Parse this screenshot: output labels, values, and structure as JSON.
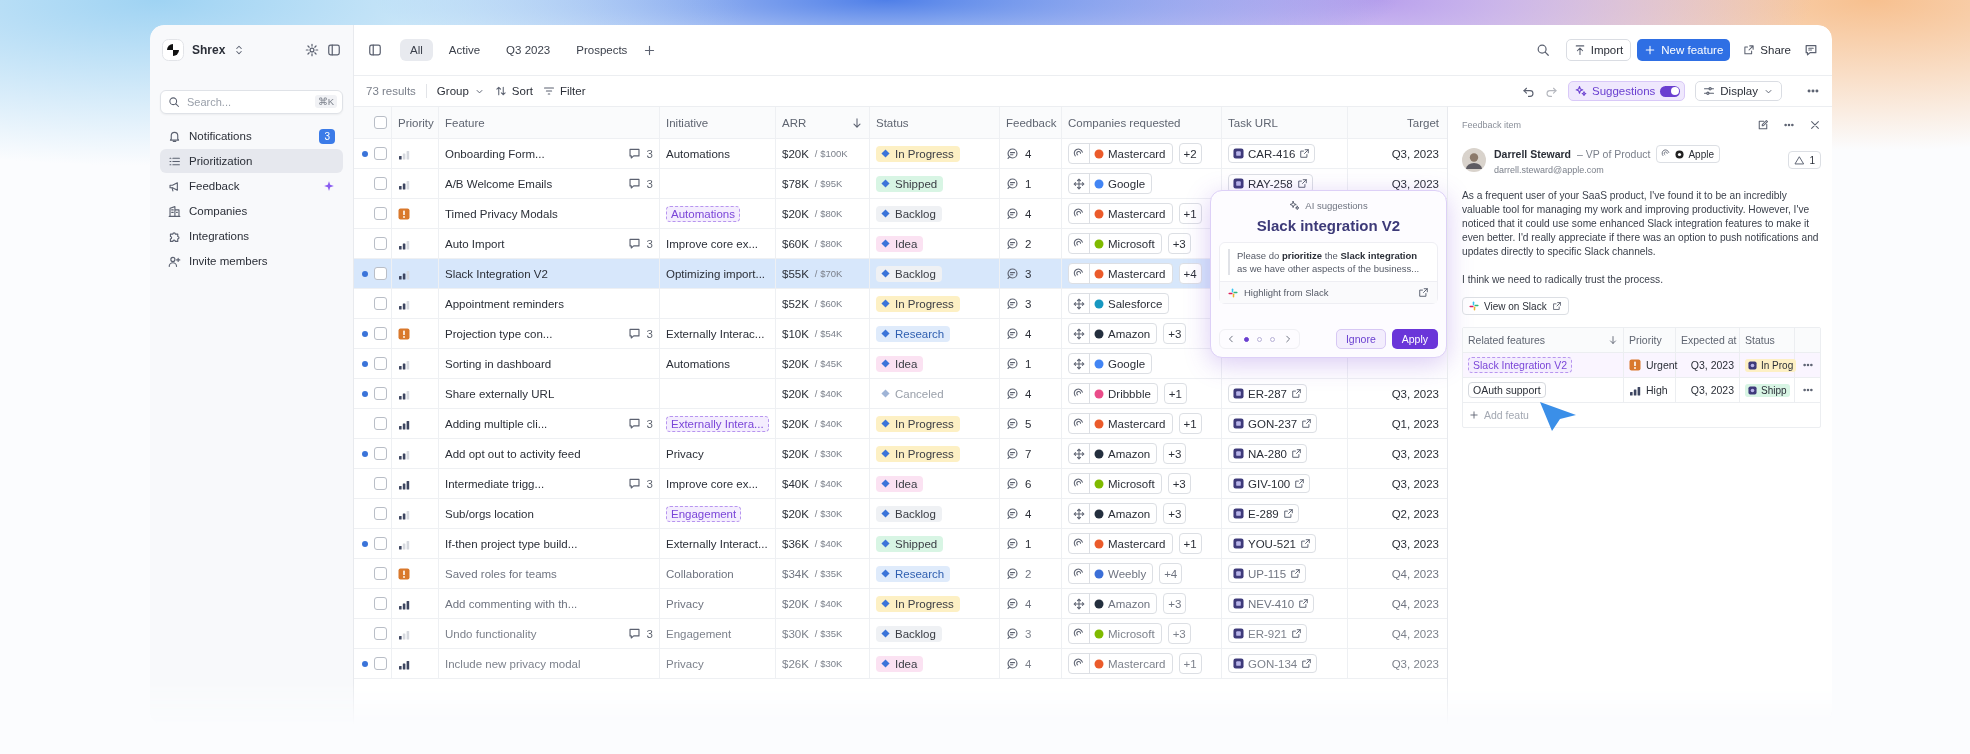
{
  "sidebar": {
    "workspace": "Shrex",
    "search": {
      "placeholder": "Search...",
      "shortcut": "⌘K"
    },
    "items": [
      {
        "label": "Notifications",
        "selected": false,
        "badge": "3"
      },
      {
        "label": "Prioritization",
        "selected": true
      },
      {
        "label": "Feedback",
        "selected": false
      },
      {
        "label": "Companies",
        "selected": false
      },
      {
        "label": "Integrations",
        "selected": false
      },
      {
        "label": "Invite members",
        "selected": false
      }
    ]
  },
  "tabs": [
    {
      "label": "All",
      "selected": true
    },
    {
      "label": "Active",
      "selected": false
    },
    {
      "label": "Q3 2023",
      "selected": false
    },
    {
      "label": "Prospects",
      "selected": false
    }
  ],
  "header_actions": {
    "import": "Import",
    "new_feature": "New feature",
    "share": "Share"
  },
  "toolbar": {
    "results": "73 results",
    "group": "Group",
    "sort": "Sort",
    "filter": "Filter",
    "suggestions": {
      "label": "Suggestions",
      "on": true
    },
    "display": "Display"
  },
  "table": {
    "select_all_checked": false,
    "columns": [
      "Priority",
      "Feature",
      "Initiative",
      "ARR",
      "Status",
      "Feedback",
      "Companies requested",
      "Task URL",
      "Target"
    ],
    "rows": [
      {
        "unread": true,
        "checked": false,
        "selected": false,
        "priority": {
          "kind": "low"
        },
        "feature": "Onboarding Form...",
        "comments": "3",
        "initiative": {
          "text": "Automations",
          "kind": "plain"
        },
        "arr": "$20K",
        "arr_total": "/ $100K",
        "status": {
          "label": "In Progress",
          "kind": "in_progress"
        },
        "feedback": "4",
        "company": {
          "kind": "swirl",
          "name": "Mastercard",
          "color": "#eb5b2b",
          "more": "+2"
        },
        "task": "CAR-416",
        "target": "Q3, 2023"
      },
      {
        "unread": false,
        "checked": false,
        "selected": false,
        "priority": {
          "kind": "medium"
        },
        "feature": "A/B Welcome Emails",
        "comments": "3",
        "arr": "$78K",
        "arr_total": "/ $95K",
        "status": {
          "label": "Shipped",
          "kind": "shipped"
        },
        "feedback": "1",
        "company": {
          "kind": "move",
          "name": "Google",
          "color": "#4285f4"
        },
        "task": "RAY-258",
        "target": "Q3, 2023"
      },
      {
        "unread": false,
        "checked": false,
        "selected": false,
        "priority": {
          "kind": "urgent"
        },
        "feature": "Timed Privacy Modals",
        "initiative": {
          "text": "Automations",
          "kind": "tag"
        },
        "arr": "$20K",
        "arr_total": "/ $80K",
        "status": {
          "label": "Backlog",
          "kind": "backlog"
        },
        "feedback": "4",
        "company": {
          "kind": "swirl",
          "name": "Mastercard",
          "color": "#eb5b2b",
          "more": "+1"
        }
      },
      {
        "unread": false,
        "checked": false,
        "selected": false,
        "priority": {
          "kind": "medium"
        },
        "feature": "Auto Import",
        "comments": "3",
        "initiative": {
          "text": "Improve core ex...",
          "kind": "plain"
        },
        "arr": "$60K",
        "arr_total": "/ $80K",
        "status": {
          "label": "Idea",
          "kind": "idea"
        },
        "feedback": "2",
        "company": {
          "kind": "swirl",
          "name": "Microsoft",
          "color": "#7fba00",
          "more": "+3"
        }
      },
      {
        "unread": true,
        "checked": false,
        "selected": true,
        "priority": {
          "kind": "medium"
        },
        "feature": "Slack Integration V2",
        "initiative": {
          "text": "Optimizing import...",
          "kind": "plain"
        },
        "arr": "$55K",
        "arr_total": "/ $70K",
        "status": {
          "label": "Backlog",
          "kind": "backlog"
        },
        "feedback": "3",
        "company": {
          "kind": "swirl",
          "name": "Mastercard",
          "color": "#eb5b2b",
          "more": "+4"
        }
      },
      {
        "unread": false,
        "checked": false,
        "selected": false,
        "priority": {
          "kind": "medium"
        },
        "feature": "Appointment reminders",
        "arr": "$52K",
        "arr_total": "/ $60K",
        "status": {
          "label": "In Progress",
          "kind": "in_progress"
        },
        "feedback": "3",
        "company": {
          "kind": "move",
          "name": "Salesforce",
          "color": "#1798c1"
        }
      },
      {
        "unread": true,
        "checked": false,
        "selected": false,
        "priority": {
          "kind": "urgent"
        },
        "feature": "Projection type con...",
        "comments": "3",
        "initiative": {
          "text": "Externally Interac...",
          "kind": "plain"
        },
        "arr": "$10K",
        "arr_total": "/ $54K",
        "status": {
          "label": "Research",
          "kind": "research"
        },
        "feedback": "4",
        "company": {
          "kind": "move",
          "name": "Amazon",
          "color": "#232f3e",
          "more": "+3"
        }
      },
      {
        "unread": true,
        "checked": false,
        "selected": false,
        "priority": {
          "kind": "medium"
        },
        "feature": "Sorting in dashboard",
        "initiative": {
          "text": "Automations",
          "kind": "plain"
        },
        "arr": "$20K",
        "arr_total": "/ $45K",
        "status": {
          "label": "Idea",
          "kind": "idea"
        },
        "feedback": "1",
        "company": {
          "kind": "move",
          "name": "Google",
          "color": "#4285f4"
        }
      },
      {
        "unread": true,
        "checked": false,
        "selected": false,
        "priority": {
          "kind": "medium"
        },
        "feature": "Share externally URL",
        "arr": "$20K",
        "arr_total": "/ $40K",
        "status": {
          "label": "Canceled",
          "kind": "canceled"
        },
        "feedback": "4",
        "company": {
          "kind": "swirl",
          "name": "Dribbble",
          "color": "#ea4c89",
          "more": "+1"
        },
        "task": "ER-287",
        "target": "Q3, 2023"
      },
      {
        "unread": false,
        "checked": false,
        "selected": false,
        "priority": {
          "kind": "high"
        },
        "feature": "Adding multiple cli...",
        "comments": "3",
        "initiative": {
          "text": "Externally Intera...",
          "kind": "tag"
        },
        "arr": "$20K",
        "arr_total": "/ $40K",
        "status": {
          "label": "In Progress",
          "kind": "in_progress"
        },
        "feedback": "5",
        "company": {
          "kind": "swirl",
          "name": "Mastercard",
          "color": "#eb5b2b",
          "more": "+1"
        },
        "task": "GON-237",
        "target": "Q1, 2023"
      },
      {
        "unread": true,
        "checked": false,
        "selected": false,
        "priority": {
          "kind": "medium"
        },
        "feature": "Add opt out to activity feed",
        "initiative": {
          "text": "Privacy",
          "kind": "plain"
        },
        "arr": "$20K",
        "arr_total": "/ $30K",
        "status": {
          "label": "In Progress",
          "kind": "in_progress"
        },
        "feedback": "7",
        "company": {
          "kind": "move",
          "name": "Amazon",
          "color": "#232f3e",
          "more": "+3"
        },
        "task": "NA-280",
        "target": "Q3, 2023"
      },
      {
        "unread": false,
        "checked": false,
        "selected": false,
        "priority": {
          "kind": "high"
        },
        "feature": "Intermediate trigg...",
        "comments": "3",
        "initiative": {
          "text": "Improve core ex...",
          "kind": "plain"
        },
        "arr": "$40K",
        "arr_total": "/ $40K",
        "status": {
          "label": "Idea",
          "kind": "idea"
        },
        "feedback": "6",
        "company": {
          "kind": "swirl",
          "name": "Microsoft",
          "color": "#7fba00",
          "more": "+3"
        },
        "task": "GIV-100",
        "target": "Q3, 2023"
      },
      {
        "unread": false,
        "checked": false,
        "selected": false,
        "priority": {
          "kind": "medium"
        },
        "feature": "Sub/orgs location",
        "initiative": {
          "text": "Engagement",
          "kind": "tag"
        },
        "arr": "$20K",
        "arr_total": "/ $30K",
        "status": {
          "label": "Backlog",
          "kind": "backlog"
        },
        "feedback": "4",
        "company": {
          "kind": "move",
          "name": "Amazon",
          "color": "#232f3e",
          "more": "+3"
        },
        "task": "E-289",
        "target": "Q2, 2023"
      },
      {
        "unread": true,
        "checked": false,
        "selected": false,
        "priority": {
          "kind": "low"
        },
        "feature": "If-then project type build...",
        "initiative": {
          "text": "Externally Interact...",
          "kind": "plain"
        },
        "arr": "$36K",
        "arr_total": "/ $40K",
        "status": {
          "label": "Shipped",
          "kind": "shipped"
        },
        "feedback": "1",
        "company": {
          "kind": "swirl",
          "name": "Mastercard",
          "color": "#eb5b2b",
          "more": "+1"
        },
        "task": "YOU-521",
        "target": "Q3, 2023"
      },
      {
        "unread": false,
        "checked": false,
        "selected": false,
        "priority": {
          "kind": "urgent"
        },
        "feature": "Saved roles for teams",
        "initiative": {
          "text": "Collaboration",
          "kind": "plain"
        },
        "arr": "$34K",
        "arr_total": "/ $35K",
        "status": {
          "label": "Research",
          "kind": "research"
        },
        "feedback": "2",
        "company": {
          "kind": "swirl",
          "name": "Weebly",
          "color": "#3b6fd8",
          "more": "+4"
        },
        "task": "UP-115",
        "target": "Q4, 2023"
      },
      {
        "unread": false,
        "checked": false,
        "selected": false,
        "priority": {
          "kind": "high"
        },
        "feature": "Add commenting with th...",
        "initiative": {
          "text": "Privacy",
          "kind": "plain"
        },
        "arr": "$20K",
        "arr_total": "/ $40K",
        "status": {
          "label": "In Progress",
          "kind": "in_progress"
        },
        "feedback": "4",
        "company": {
          "kind": "move",
          "name": "Amazon",
          "color": "#232f3e",
          "more": "+3"
        },
        "task": "NEV-410",
        "target": "Q4, 2023"
      },
      {
        "unread": false,
        "checked": false,
        "selected": false,
        "priority": {
          "kind": "low"
        },
        "feature": "Undo functionality",
        "comments": "3",
        "initiative": {
          "text": "Engagement",
          "kind": "plain"
        },
        "arr": "$30K",
        "arr_total": "/ $35K",
        "status": {
          "label": "Backlog",
          "kind": "backlog"
        },
        "feedback": "3",
        "company": {
          "kind": "swirl",
          "name": "Microsoft",
          "color": "#7fba00",
          "more": "+3"
        },
        "task": "ER-921",
        "target": "Q4, 2023"
      },
      {
        "unread": true,
        "checked": false,
        "selected": false,
        "priority": {
          "kind": "high"
        },
        "feature": "Include new privacy modal",
        "initiative": {
          "text": "Privacy",
          "kind": "plain"
        },
        "arr": "$26K",
        "arr_total": "/ $30K",
        "status": {
          "label": "Idea",
          "kind": "idea"
        },
        "feedback": "4",
        "company": {
          "kind": "swirl",
          "name": "Mastercard",
          "color": "#eb5b2b",
          "more": "+1"
        },
        "task": "GON-134",
        "target": "Q3, 2023"
      }
    ]
  },
  "suggestion_popup": {
    "label": "AI suggestions",
    "title": "Slack integration V2",
    "quote": "Please do **prioritize** the **Slack integration** as we have other aspects of the business...",
    "source": "Highlight from Slack",
    "pages": [
      {
        "selected": true
      },
      {
        "selected": false
      },
      {
        "selected": false
      }
    ],
    "ignore": "Ignore",
    "apply": "Apply"
  },
  "feedback_panel": {
    "title": "Feedback item",
    "author": {
      "name": "Darrell Steward",
      "role": "– VP of Product",
      "email": "darrell.steward@apple.com",
      "company": "Apple"
    },
    "upvotes": "1",
    "paragraphs": [
      "As a frequent user of your SaaS product, I've found it to be an incredibly valuable tool for managing my work and improving productivity. However, I've noticed that it could use some enhanced Slack integration features to make it even better. I'd really appreciate if there was an option to push notifications and updates directly to specific Slack channels.",
      "I think we need to radically trust the process."
    ],
    "view_link": "View on Slack",
    "related": {
      "columns": [
        "Related features",
        "Priority",
        "Expected at",
        "Status"
      ],
      "rows": [
        {
          "feature": "Slack Integration V2",
          "kind": "tag",
          "priority": {
            "label": "Urgent",
            "kind": "urgent"
          },
          "expected": "Q3, 2023",
          "status": {
            "label": "In Prog",
            "kind": "in_progress"
          }
        },
        {
          "feature": "OAuth support",
          "kind": "chip",
          "priority": {
            "label": "High",
            "kind": "high"
          },
          "expected": "Q3, 2023",
          "status": {
            "label": "Shipp",
            "kind": "shipped"
          }
        }
      ],
      "add": "Add featu"
    }
  }
}
